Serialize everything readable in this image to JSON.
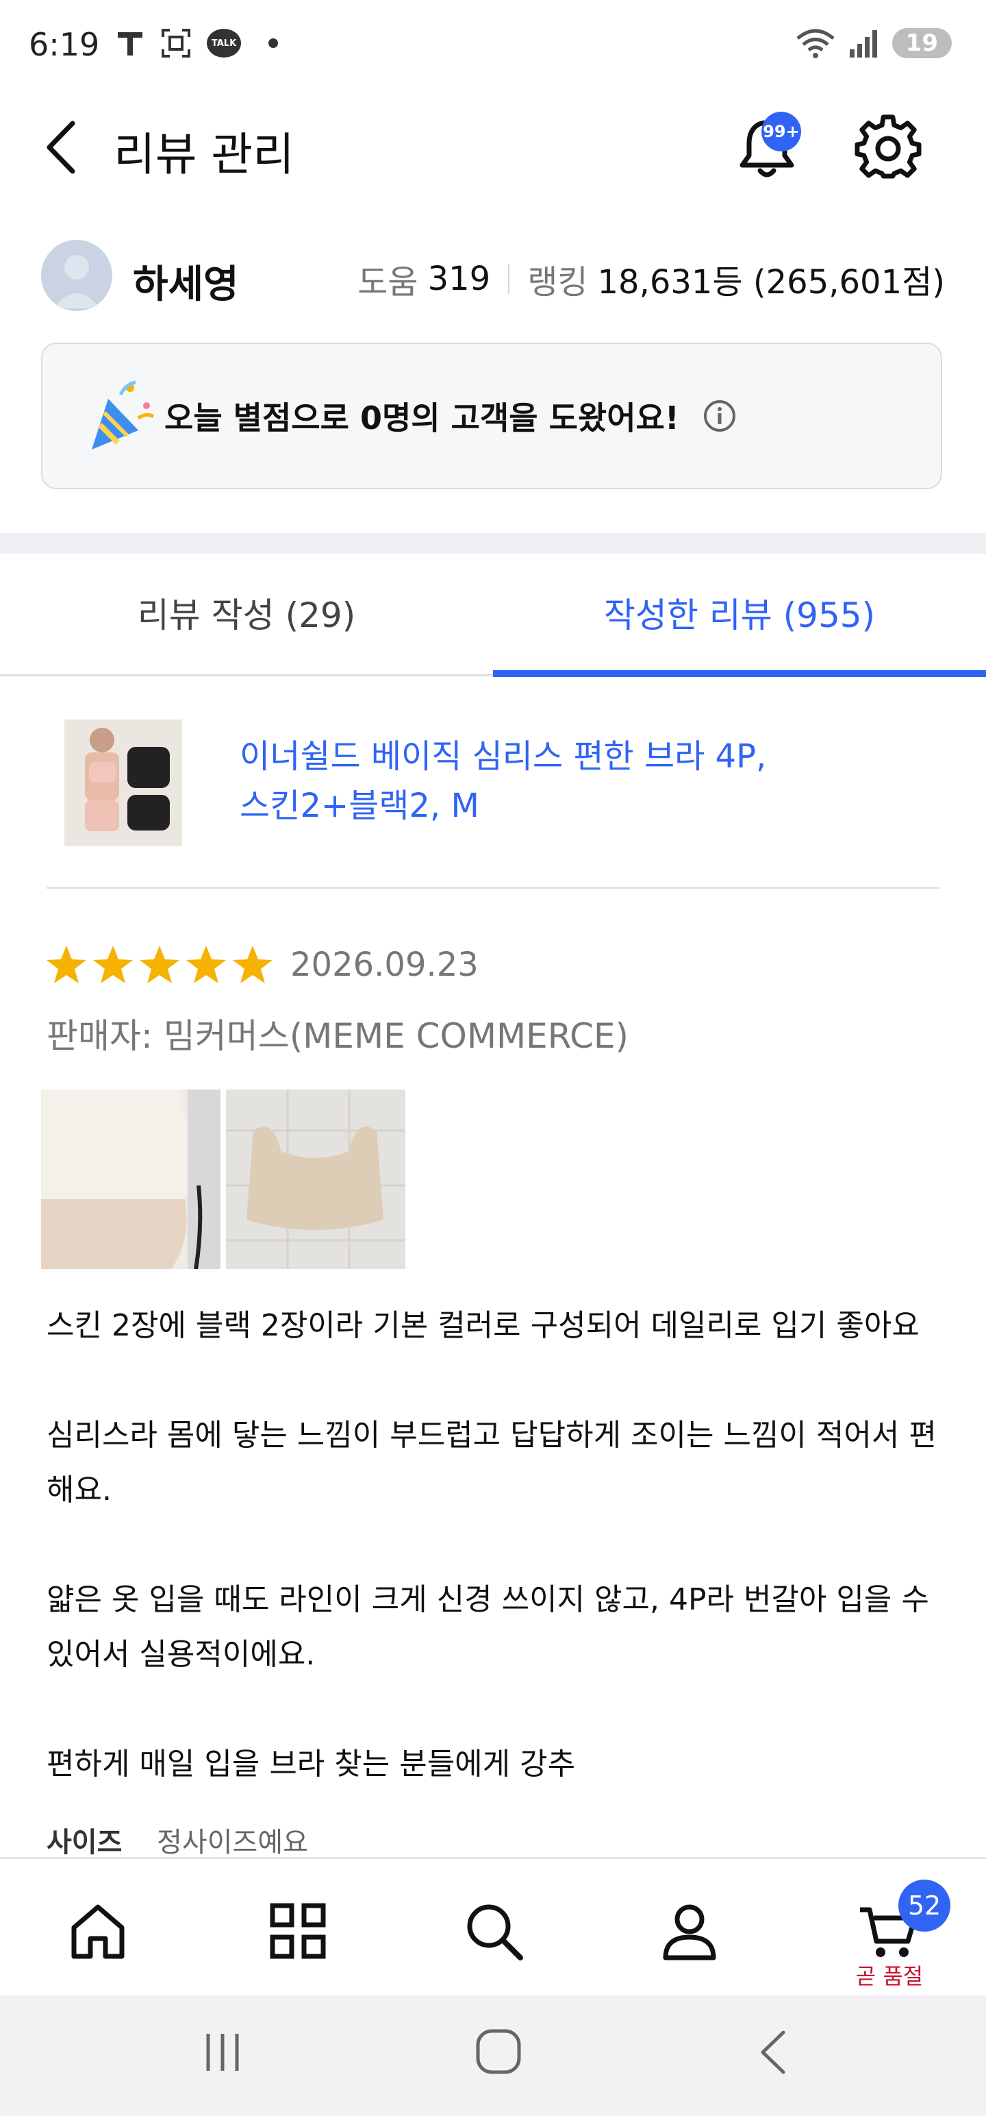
{
  "status_bar": {
    "time": "6:19",
    "battery": "19",
    "left_icons": [
      "tmap-t-icon",
      "screenshot-icon",
      "talk-icon",
      "dot-icon"
    ],
    "right_icons": [
      "wifi-icon",
      "signal-icon"
    ],
    "talk_text": "TALK"
  },
  "header": {
    "title": "리뷰 관리",
    "notification_badge": "99+"
  },
  "profile": {
    "name": "하세영",
    "help_label": "도움",
    "help_count": "319",
    "ranking_label": "랭킹",
    "ranking_value": "18,631등 (265,601점)"
  },
  "helper_box": {
    "message": "오늘 별점으로 0명의 고객을 도왔어요!"
  },
  "tabs": [
    {
      "label": "리뷰 작성 (29)",
      "active": false
    },
    {
      "label": "작성한 리뷰 (955)",
      "active": true
    }
  ],
  "product": {
    "title_line1": "이너쉴드 베이직 심리스 편한 브라 4P,",
    "title_line2": "스킨2+블랙2, M"
  },
  "review": {
    "rating": 5,
    "date": "2026.09.23",
    "seller": "판매자: 밈커머스(MEME COMMERCE)",
    "paragraphs": [
      "스킨 2장에 블랙 2장이라 기본 컬러로 구성되어 데일리로 입기 좋아요",
      "심리스라 몸에 닿는 느낌이 부드럽고 답답하게 조이는 느낌이 적어서 편해요.",
      "얇은 옷 입을 때도 라인이 크게 신경 쓰이지 않고, 4P라 번갈아 입을 수 있어서 실용적이에요.",
      "편하게 매일 입을 브라 찾는 분들에게 강추"
    ],
    "size_label": "사이즈",
    "size_value": "정사이즈예요"
  },
  "bottom_nav": {
    "items": [
      "home-icon",
      "category-icon",
      "search-icon",
      "my-page-icon",
      "cart-icon"
    ],
    "cart_badge": "52",
    "cart_label": "곧 품절"
  },
  "colors": {
    "accent": "#2f64f4",
    "star": "#f6b200",
    "alert": "#c8102e"
  }
}
